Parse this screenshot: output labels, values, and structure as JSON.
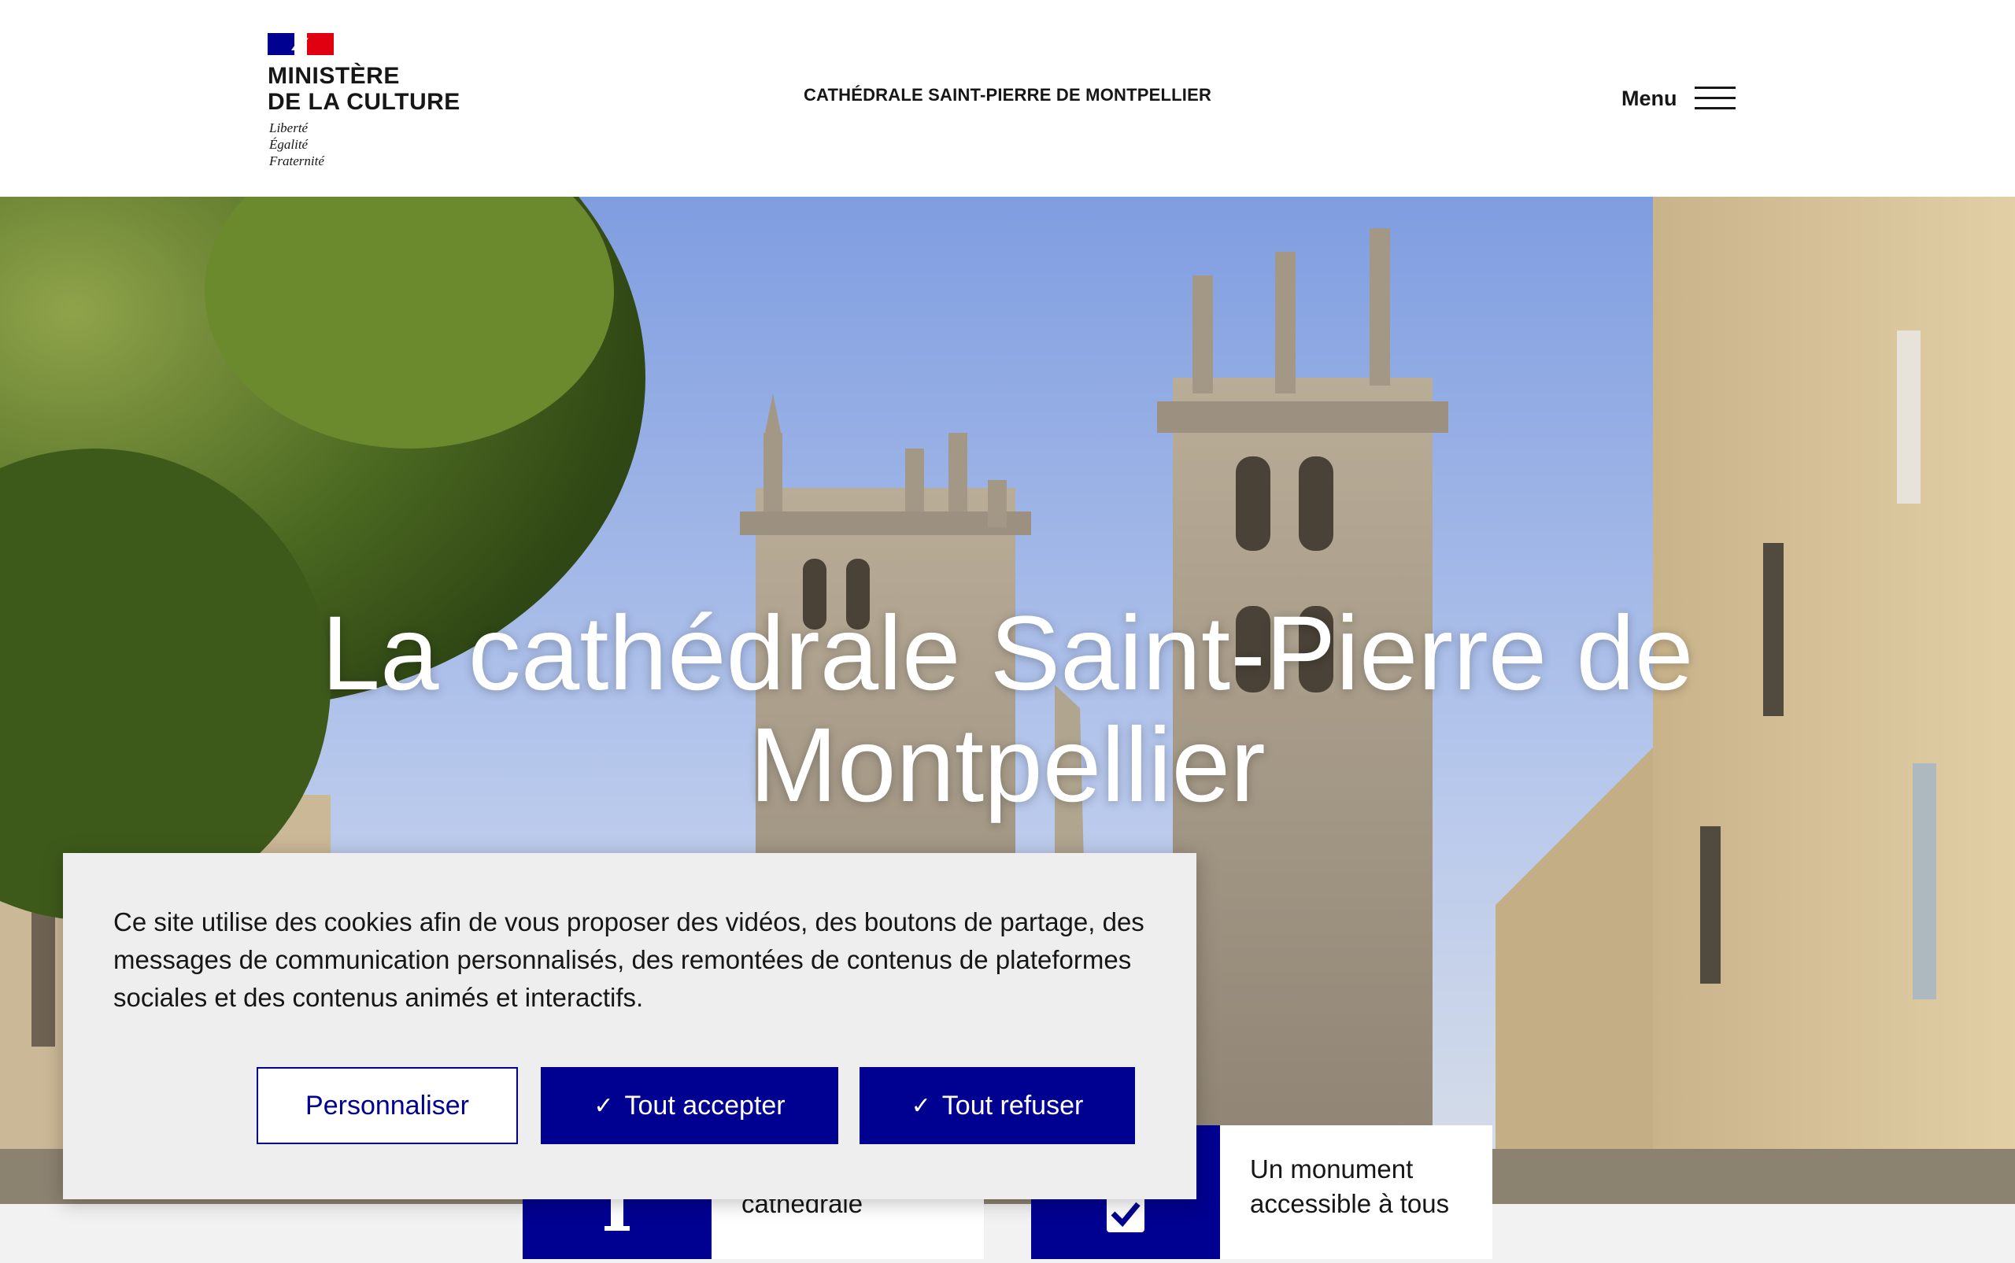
{
  "header": {
    "ministry_name": "MINISTÈRE\nDE LA CULTURE",
    "motto": "Liberté\nÉgalité\nFraternité",
    "site_title": "CATHÉDRALE SAINT-PIERRE DE MONTPELLIER",
    "menu_label": "Menu"
  },
  "hero": {
    "title": "La cathédrale Saint-Pierre de Montpellier"
  },
  "quick_access": [
    {
      "label": "Visiter la\ncathédrale",
      "icon": "info-icon"
    },
    {
      "label": "Un monument\naccessible à tous",
      "icon": "check-icon"
    }
  ],
  "cookie_banner": {
    "text": "Ce site utilise des cookies afin de vous proposer des vidéos, des boutons de partage, des messages de communication personnalisés, des remontées de contenus de plateformes sociales et des contenus animés et interactifs.",
    "customize_label": "Personnaliser",
    "accept_label": "Tout accepter",
    "refuse_label": "Tout refuser",
    "check_glyph": "✓"
  },
  "colors": {
    "primary": "#000091",
    "text": "#161616",
    "flag_blue": "#000091",
    "flag_red": "#E1000F"
  }
}
